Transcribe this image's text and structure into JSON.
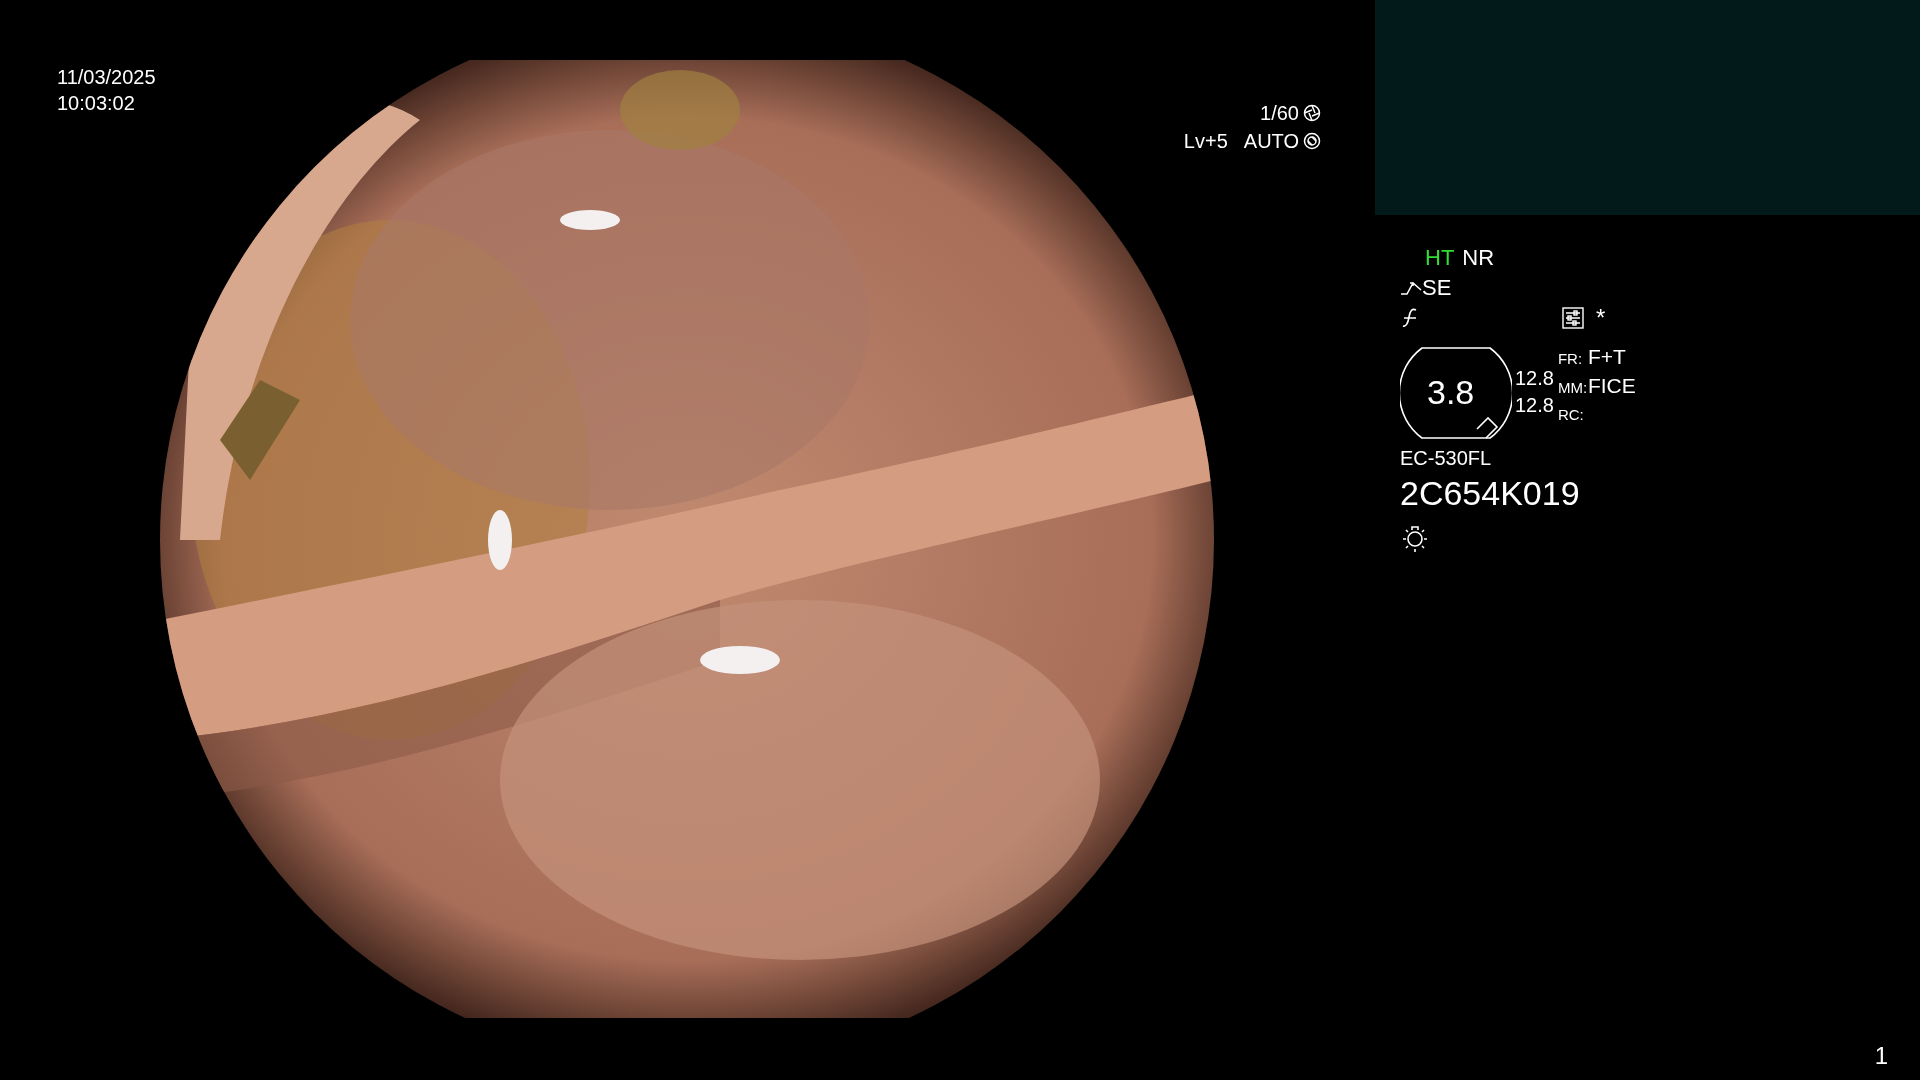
{
  "timestamp": {
    "date": "11/03/2025",
    "time": "10:03:02"
  },
  "exposure": {
    "shutter": "1/60",
    "level": "Lv+5",
    "mode": "AUTO"
  },
  "status": {
    "modes": [
      {
        "label": "HT",
        "active": true
      },
      {
        "label": "NR",
        "active": false
      }
    ],
    "enhancement": "SE",
    "marker": "*"
  },
  "zoom": {
    "value": "3.8",
    "readings": [
      "12.8",
      "12.8"
    ]
  },
  "settings": [
    {
      "key": "FR:",
      "value": "F+T"
    },
    {
      "key": "MM:",
      "value": "FICE"
    },
    {
      "key": "RC:"
    }
  ],
  "scope": {
    "model": "EC-530FL",
    "serial": "2C654K019"
  },
  "page_number": "1"
}
